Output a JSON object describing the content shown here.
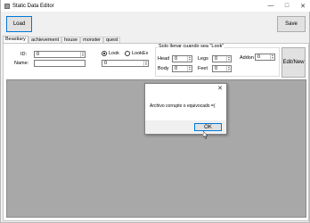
{
  "window": {
    "title": "Static Data Editor",
    "minimize": "—",
    "maximize": "□",
    "close": "✕"
  },
  "toolbar": {
    "load_label": "Load",
    "save_label": "Save"
  },
  "tabs": [
    {
      "label": "Beastiary",
      "active": true
    },
    {
      "label": "achievement"
    },
    {
      "label": "house"
    },
    {
      "label": "monster"
    },
    {
      "label": "quest"
    }
  ],
  "form": {
    "id_label": "ID:",
    "id_value": "0",
    "name_label": "Name:",
    "name_value": "",
    "look_label": "Look",
    "lookex_label": "LookEx",
    "look_value": "0",
    "fill_note": "Solo llenar cuando sea \"Look\"",
    "head_label": "Head",
    "head_value": "0",
    "legs_label": "Legs",
    "legs_value": "0",
    "addon_label": "Addon",
    "addon_value": "0",
    "body_label": "Body",
    "body_value": "0",
    "feet_label": "Feet",
    "feet_value": "0",
    "edit_new_label": "Edit/New"
  },
  "dialog": {
    "close": "✕",
    "message": "Archivo corrupto o equivocado =(",
    "ok_label": "OK"
  }
}
